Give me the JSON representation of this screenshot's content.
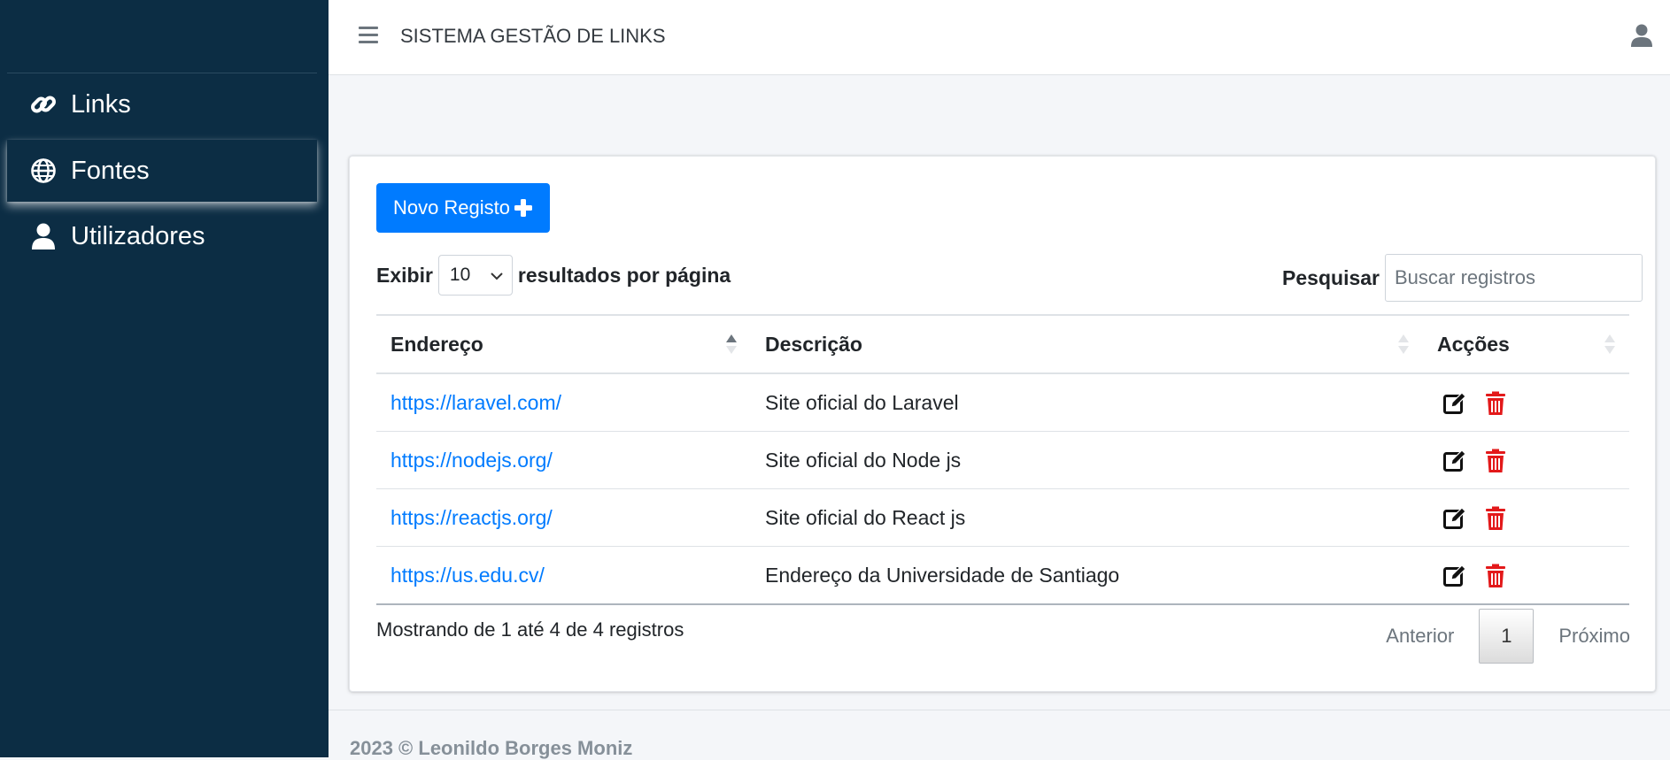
{
  "app": {
    "title": "SISTEMA GESTÃO DE LINKS"
  },
  "sidebar": {
    "items": [
      {
        "label": "Links",
        "icon": "link-icon"
      },
      {
        "label": "Fontes",
        "icon": "globe-icon",
        "active": true
      },
      {
        "label": "Utilizadores",
        "icon": "user-icon"
      }
    ]
  },
  "toolbar": {
    "new_label": "Novo Registo"
  },
  "length": {
    "prefix": "Exibir",
    "value": "10",
    "suffix": "resultados por página"
  },
  "search": {
    "label": "Pesquisar",
    "placeholder": "Buscar registros"
  },
  "table": {
    "headers": [
      "Endereço",
      "Descrição",
      "Acções"
    ],
    "rows": [
      {
        "url": "https://laravel.com/",
        "description": "Site oficial do Laravel"
      },
      {
        "url": "https://nodejs.org/",
        "description": "Site oficial do Node js"
      },
      {
        "url": "https://reactjs.org/",
        "description": "Site oficial do React js"
      },
      {
        "url": "https://us.edu.cv/",
        "description": "Endereço da Universidade de Santiago"
      }
    ]
  },
  "pagination": {
    "info": "Mostrando de 1 até 4 de 4 registros",
    "previous": "Anterior",
    "current": "1",
    "next": "Próximo"
  },
  "footer": {
    "text": "2023 © Leonildo Borges Moniz"
  },
  "colors": {
    "sidebar": "#0c2d44",
    "primary": "#007bff",
    "danger": "#e3191a"
  }
}
